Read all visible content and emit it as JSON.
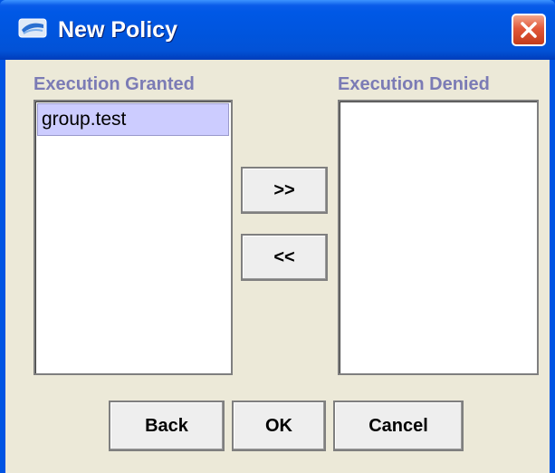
{
  "window": {
    "title": "New Policy"
  },
  "granted": {
    "label": "Execution Granted",
    "items": [
      "group.test"
    ]
  },
  "denied": {
    "label": "Execution Denied",
    "items": []
  },
  "buttons": {
    "move_right": ">>",
    "move_left": "<<",
    "back": "Back",
    "ok": "OK",
    "cancel": "Cancel"
  },
  "colors": {
    "titlebar": "#0055de",
    "close": "#e2583a",
    "dialog_bg": "#ece9d8",
    "label": "#7b7bb5",
    "selected_item": "#ccccff"
  },
  "icons": {
    "app": "app-window-icon",
    "close": "close-icon"
  }
}
